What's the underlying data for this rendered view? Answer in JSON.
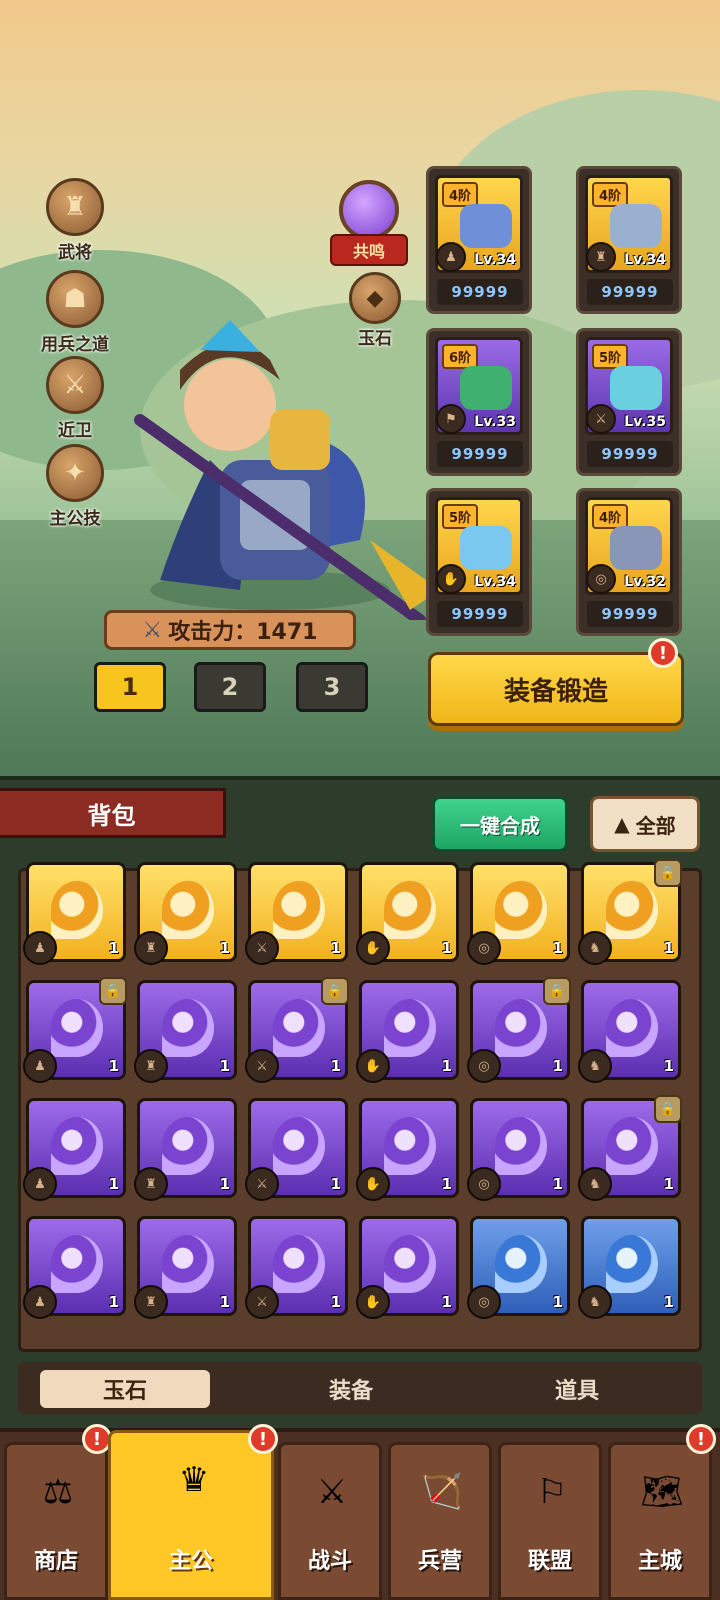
{
  "side_menu": [
    {
      "label": "武将",
      "icon": "general-icon"
    },
    {
      "label": "用兵之道",
      "icon": "tactics-icon"
    },
    {
      "label": "近卫",
      "icon": "guard-icon"
    },
    {
      "label": "主公技",
      "icon": "lord-skill-icon"
    }
  ],
  "resonance_label": "共鸣",
  "jade_label": "玉石",
  "hero": {
    "attack_text": "攻击力：1471"
  },
  "page_tabs": [
    "1",
    "2",
    "3"
  ],
  "active_page_tab": "1",
  "equipment": [
    {
      "tier": "4阶",
      "level": "Lv.34",
      "value": "99999",
      "frame": "gold",
      "color": "#6f8fd8"
    },
    {
      "tier": "4阶",
      "level": "Lv.34",
      "value": "99999",
      "frame": "gold",
      "color": "#9ab0d0"
    },
    {
      "tier": "6阶",
      "level": "Lv.33",
      "value": "99999",
      "frame": "purple",
      "color": "#3fb070"
    },
    {
      "tier": "5阶",
      "level": "Lv.35",
      "value": "99999",
      "frame": "purple",
      "color": "#6ad0e0"
    },
    {
      "tier": "5阶",
      "level": "Lv.34",
      "value": "99999",
      "frame": "gold",
      "color": "#7ac8f0"
    },
    {
      "tier": "4阶",
      "level": "Lv.32",
      "value": "99999",
      "frame": "gold",
      "color": "#8a96b8"
    }
  ],
  "forge_button": "装备锻造",
  "bag": {
    "title": "背包",
    "merge_button": "一键合成",
    "filter_button": "全部"
  },
  "grid_items": [
    {
      "rarity": "gold",
      "count": "1",
      "locked": false
    },
    {
      "rarity": "gold",
      "count": "1",
      "locked": false
    },
    {
      "rarity": "gold",
      "count": "1",
      "locked": false
    },
    {
      "rarity": "gold",
      "count": "1",
      "locked": false
    },
    {
      "rarity": "gold",
      "count": "1",
      "locked": false
    },
    {
      "rarity": "gold",
      "count": "1",
      "locked": true
    },
    {
      "rarity": "purple",
      "count": "1",
      "locked": true
    },
    {
      "rarity": "purple",
      "count": "1",
      "locked": false
    },
    {
      "rarity": "purple",
      "count": "1",
      "locked": true
    },
    {
      "rarity": "purple",
      "count": "1",
      "locked": false
    },
    {
      "rarity": "purple",
      "count": "1",
      "locked": true
    },
    {
      "rarity": "purple",
      "count": "1",
      "locked": false
    },
    {
      "rarity": "purple",
      "count": "1",
      "locked": false
    },
    {
      "rarity": "purple",
      "count": "1",
      "locked": false
    },
    {
      "rarity": "purple",
      "count": "1",
      "locked": false
    },
    {
      "rarity": "purple",
      "count": "1",
      "locked": false
    },
    {
      "rarity": "purple",
      "count": "1",
      "locked": false
    },
    {
      "rarity": "purple",
      "count": "1",
      "locked": true
    },
    {
      "rarity": "purple",
      "count": "1",
      "locked": false
    },
    {
      "rarity": "purple",
      "count": "1",
      "locked": false
    },
    {
      "rarity": "purple",
      "count": "1",
      "locked": false
    },
    {
      "rarity": "purple",
      "count": "1",
      "locked": false
    },
    {
      "rarity": "blue",
      "count": "1",
      "locked": false
    },
    {
      "rarity": "blue",
      "count": "1",
      "locked": false
    }
  ],
  "categories": [
    "玉石",
    "装备",
    "道具"
  ],
  "active_category": "玉石",
  "nav": [
    {
      "label": "商店",
      "icon": "shop-icon",
      "alert": true
    },
    {
      "label": "主公",
      "icon": "lord-icon",
      "alert": true
    },
    {
      "label": "战斗",
      "icon": "battle-icon",
      "alert": false
    },
    {
      "label": "兵营",
      "icon": "barracks-icon",
      "alert": false
    },
    {
      "label": "联盟",
      "icon": "alliance-icon",
      "alert": false
    },
    {
      "label": "主城",
      "icon": "city-icon",
      "alert": true
    }
  ],
  "active_nav": "主公"
}
